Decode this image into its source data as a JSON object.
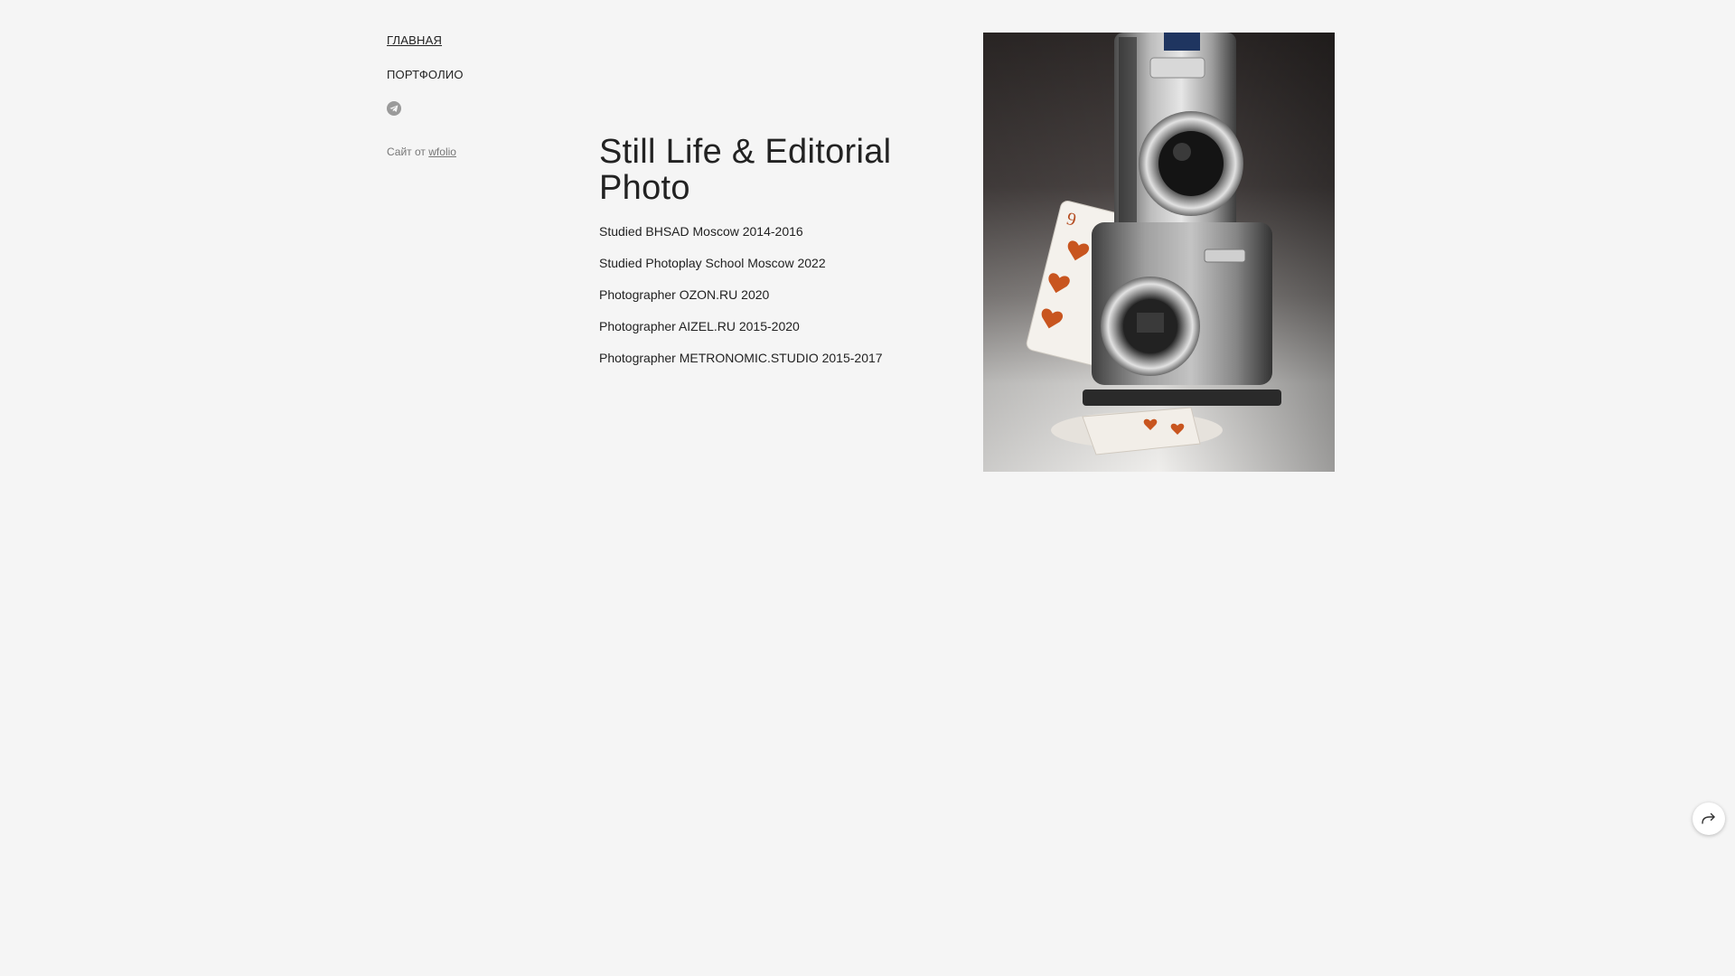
{
  "nav": {
    "home_label": "ГЛАВНАЯ",
    "portfolio_label": "ПОРТФОЛИО"
  },
  "social": {
    "icon": "telegram-icon"
  },
  "credit": {
    "prefix": "Сайт от",
    "link_label": "wfolio"
  },
  "content": {
    "title": "Still Life & Editorial Photo",
    "facts": [
      "Studied BHSAD Moscow 2014-2016",
      "Studied Photoplay School Moscow 2022",
      "Photographer OZON.RU 2020",
      "Photographer AIZEL.RU 2015-2020",
      "Photographer METRONOMIC.STUDIO 2015-2017"
    ]
  },
  "photo": {
    "subject": "compact cameras stacked on playing cards"
  },
  "share": {
    "icon": "share-arrow-icon"
  },
  "colors": {
    "background": "#f5f5f5",
    "text": "#222222",
    "muted": "#777777"
  }
}
